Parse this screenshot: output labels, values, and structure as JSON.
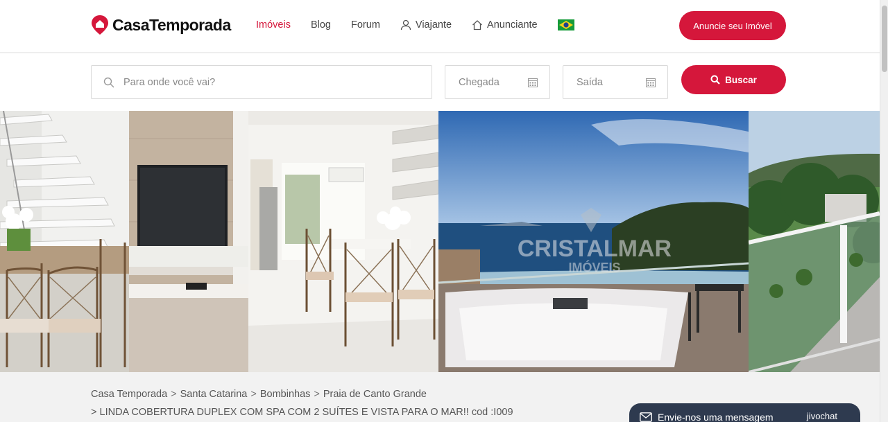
{
  "brand": {
    "name": "CasaTemporada",
    "color": "#d5173b"
  },
  "nav": {
    "items": [
      {
        "label": "Imóveis",
        "active": true
      },
      {
        "label": "Blog",
        "active": false
      },
      {
        "label": "Forum",
        "active": false
      },
      {
        "label": "Viajante",
        "icon": "user-icon",
        "active": false
      },
      {
        "label": "Anunciante",
        "icon": "home-icon",
        "active": false
      }
    ],
    "language_flag": "brazil-flag-icon",
    "cta_label": "Anuncie seu Imóvel"
  },
  "search": {
    "placeholder": "Para onde você vai?",
    "checkin_label": "Chegada",
    "checkout_label": "Saída",
    "button_label": "Buscar"
  },
  "gallery": {
    "photos": [
      "living-room-stairs",
      "living-room-tv-dining",
      "balcony-spa-sea-view",
      "balcony-garden-view"
    ],
    "watermark_line1": "CRISTALMAR",
    "watermark_line2": "IMÓVEIS"
  },
  "breadcrumb": {
    "items": [
      "Casa Temporada",
      "Santa Catarina",
      "Bombinhas",
      "Praia de Canto Grande"
    ],
    "separator": ">",
    "current_title": "LINDA COBERTURA DUPLEX COM SPA COM 2 SUÍTES E VISTA PARA O MAR!! cod :I009"
  },
  "chat": {
    "label": "Envie-nos uma mensagem",
    "brand": "jivochat"
  }
}
